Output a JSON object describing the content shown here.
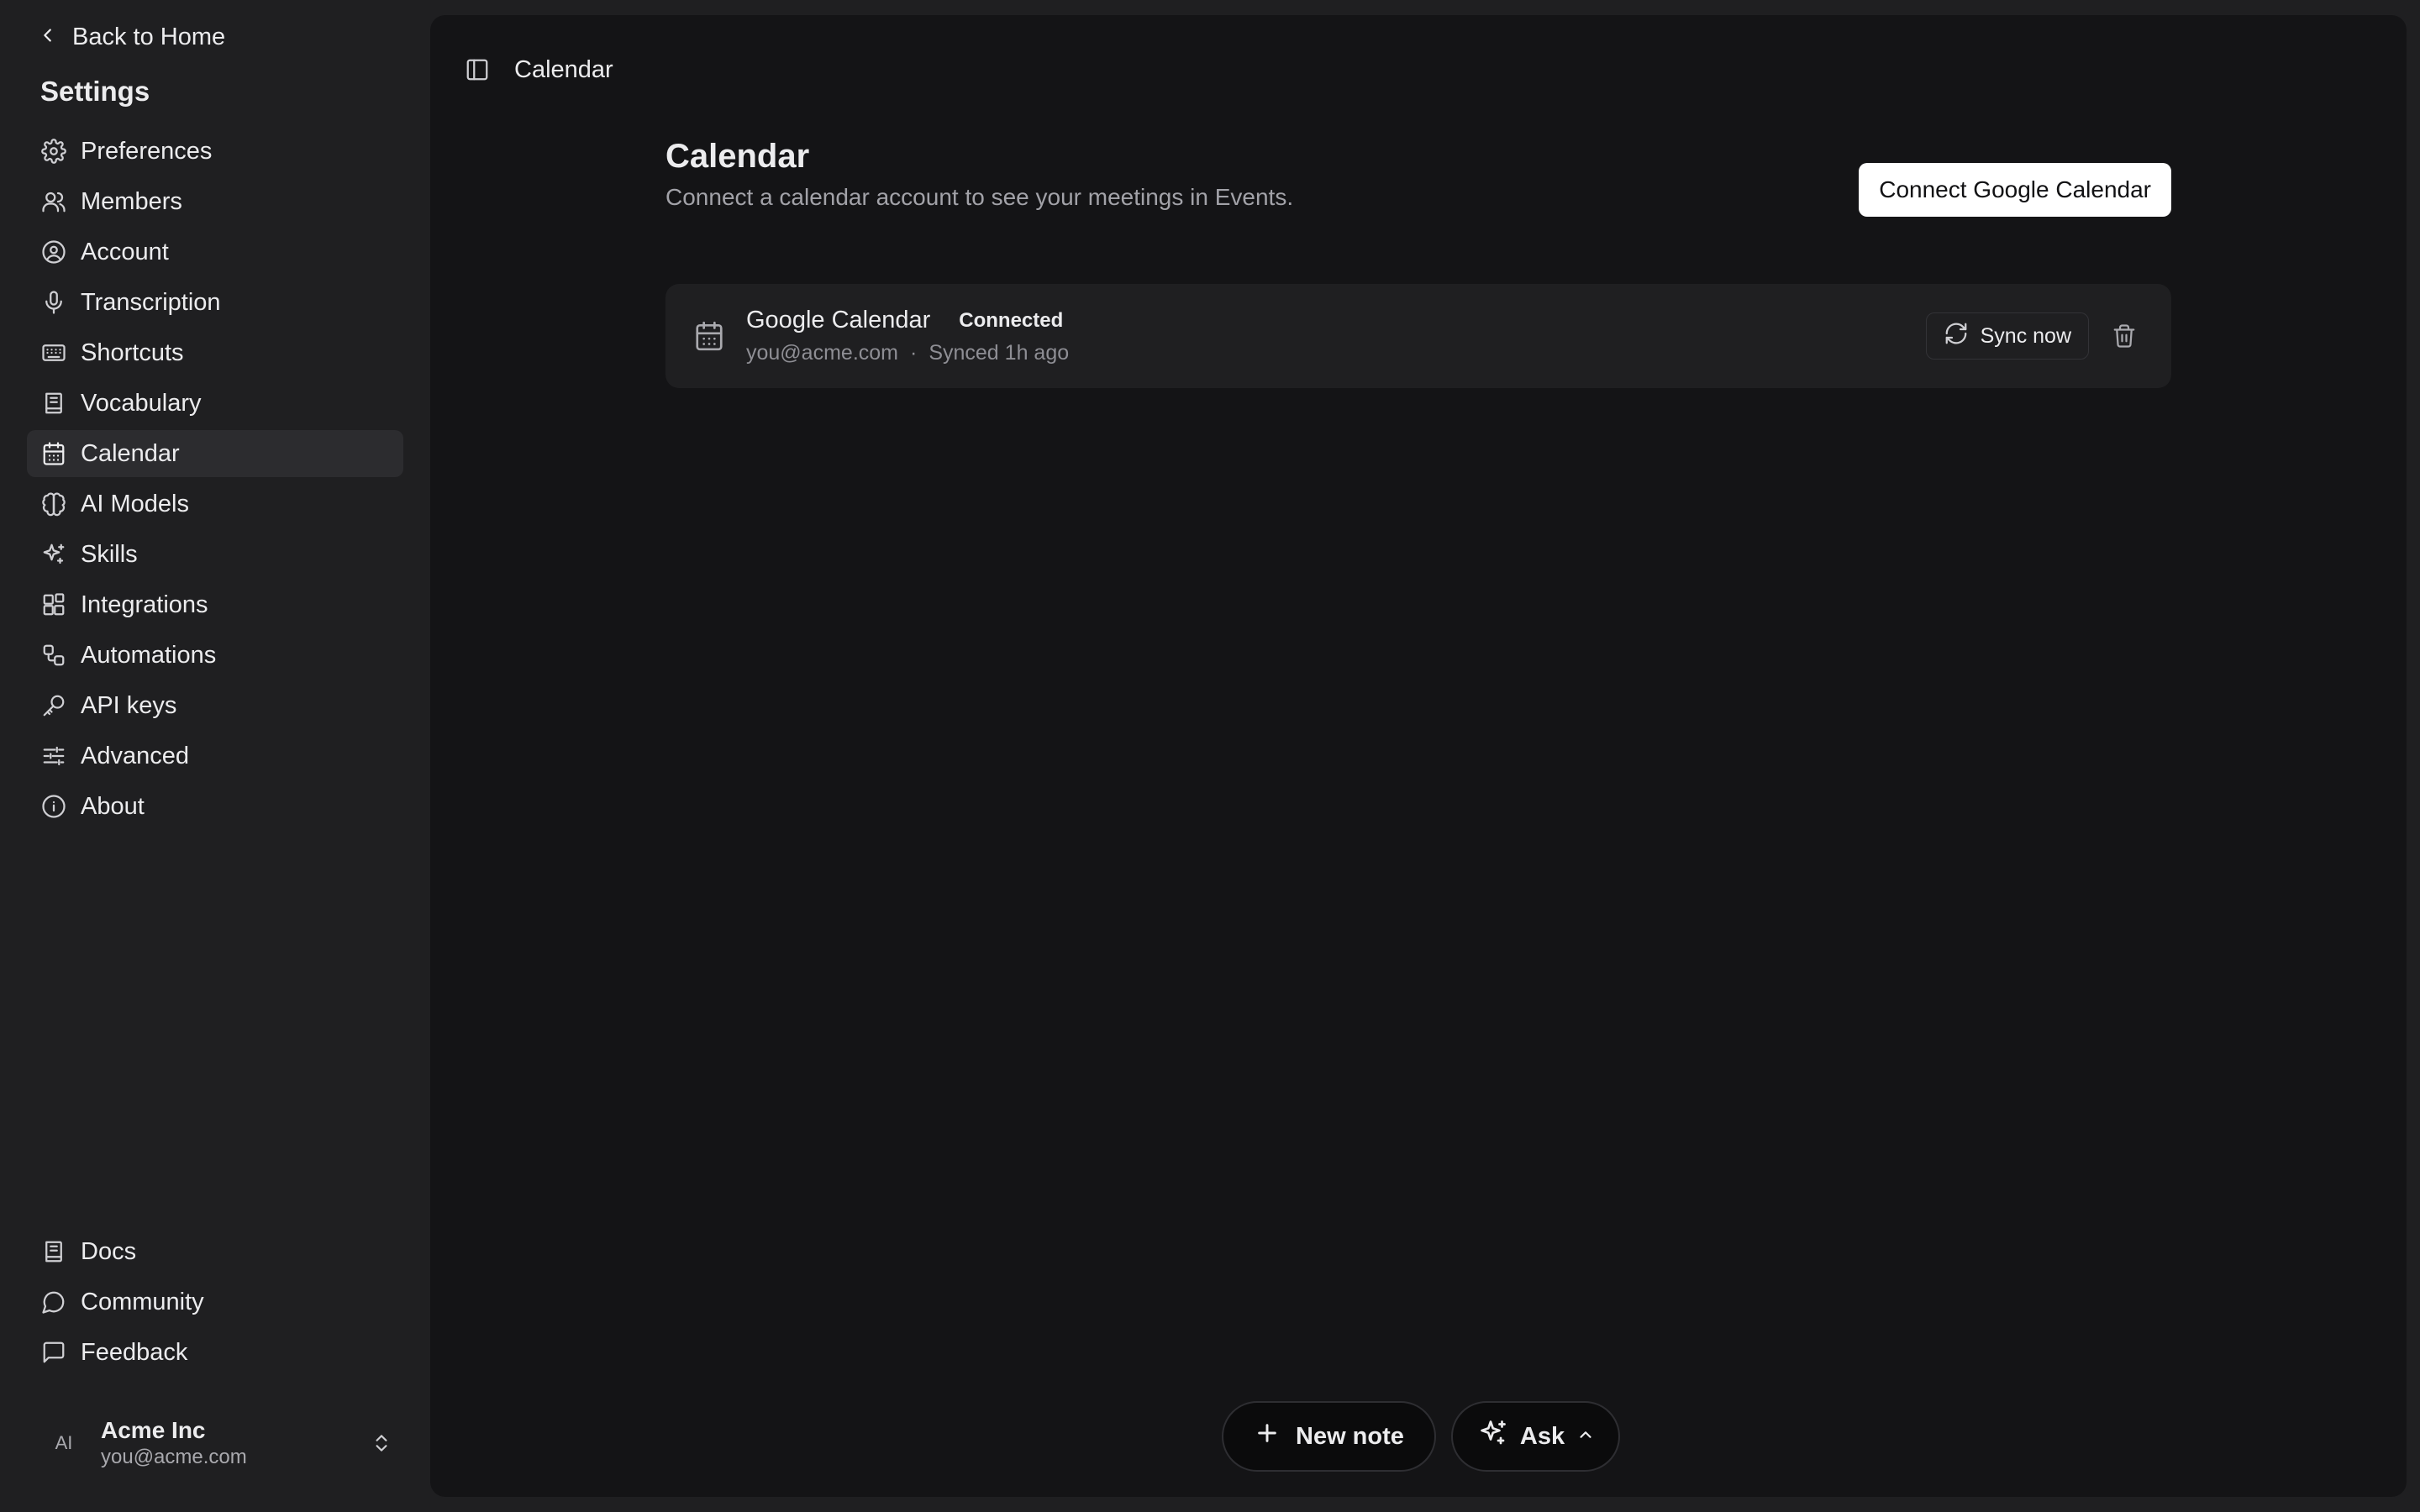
{
  "sidebar": {
    "back_label": "Back to Home",
    "settings_title": "Settings",
    "items": [
      {
        "label": "Preferences",
        "icon": "gear-icon"
      },
      {
        "label": "Members",
        "icon": "users-icon"
      },
      {
        "label": "Account",
        "icon": "user-circle-icon"
      },
      {
        "label": "Transcription",
        "icon": "microphone-icon"
      },
      {
        "label": "Shortcuts",
        "icon": "keyboard-icon"
      },
      {
        "label": "Vocabulary",
        "icon": "book-icon"
      },
      {
        "label": "Calendar",
        "icon": "calendar-icon",
        "active": true
      },
      {
        "label": "AI Models",
        "icon": "brain-icon"
      },
      {
        "label": "Skills",
        "icon": "sparkles-icon"
      },
      {
        "label": "Integrations",
        "icon": "blocks-icon"
      },
      {
        "label": "Automations",
        "icon": "workflow-icon"
      },
      {
        "label": "API keys",
        "icon": "key-icon"
      },
      {
        "label": "Advanced",
        "icon": "sliders-icon"
      },
      {
        "label": "About",
        "icon": "info-icon"
      }
    ],
    "bottom_items": [
      {
        "label": "Docs",
        "icon": "book-icon"
      },
      {
        "label": "Community",
        "icon": "chat-bubble-icon"
      },
      {
        "label": "Feedback",
        "icon": "message-square-icon"
      }
    ],
    "user": {
      "avatar_initials": "AI",
      "name": "Acme Inc",
      "email": "you@acme.com"
    }
  },
  "topbar": {
    "title": "Calendar"
  },
  "main": {
    "title": "Calendar",
    "subtitle": "Connect a calendar account to see your meetings in Events.",
    "connect_button": "Connect Google Calendar",
    "account_card": {
      "name": "Google Calendar",
      "status": "Connected",
      "email": "you@acme.com",
      "separator": "·",
      "synced": "Synced 1h ago",
      "sync_button": "Sync now"
    }
  },
  "footer": {
    "new_note": "New note",
    "ask": "Ask"
  },
  "colors": {
    "sidebar_bg": "#1f1f21",
    "main_bg": "#141416",
    "card_bg": "#1f1f21",
    "primary_button_bg": "#ffffff"
  }
}
